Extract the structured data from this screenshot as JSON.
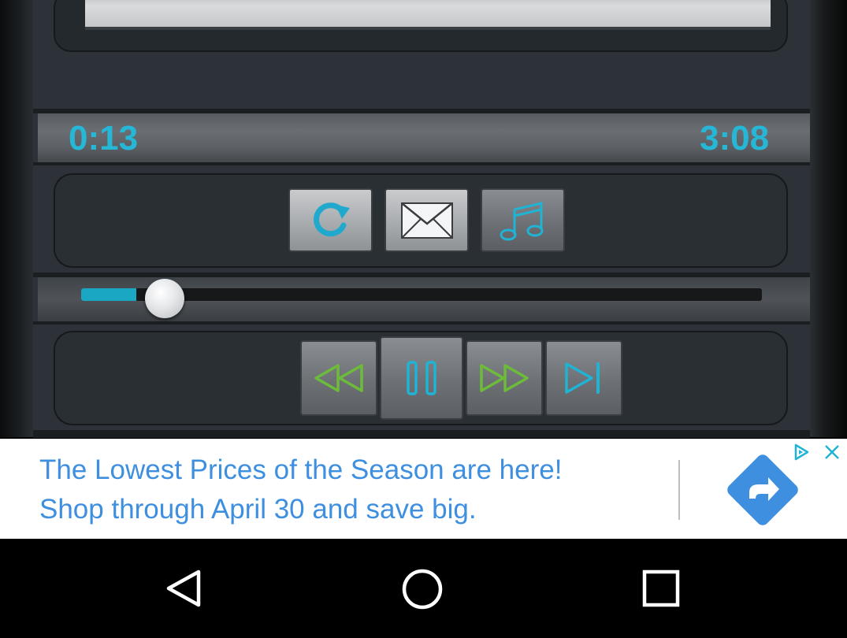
{
  "player": {
    "elapsed": "0:13",
    "duration": "3:08",
    "progress_fraction": 0.07
  },
  "action_buttons": [
    {
      "name": "repeat-button",
      "icon": "repeat-icon"
    },
    {
      "name": "share-email-button",
      "icon": "mail-icon"
    },
    {
      "name": "playlist-button",
      "icon": "music-note-icon"
    }
  ],
  "transport_buttons": [
    {
      "name": "rewind-button",
      "icon": "rewind-icon"
    },
    {
      "name": "pause-button",
      "icon": "pause-icon"
    },
    {
      "name": "fast-forward-button",
      "icon": "fast-forward-icon"
    },
    {
      "name": "next-track-button",
      "icon": "skip-next-icon"
    }
  ],
  "ad": {
    "line1": "The Lowest Prices of the Season are here!",
    "line2": "Shop through April 30 and save big.",
    "choices_icon": "adchoices-icon",
    "close_icon": "close-icon",
    "cta_icon": "forward-arrow-icon"
  },
  "nav": {
    "back_icon": "back-triangle-icon",
    "home_icon": "home-circle-icon",
    "recents_icon": "recents-square-icon"
  },
  "colors": {
    "accent": "#27b7d6",
    "icon_green": "#6dbb3a",
    "ad_blue": "#3e8fe0"
  }
}
